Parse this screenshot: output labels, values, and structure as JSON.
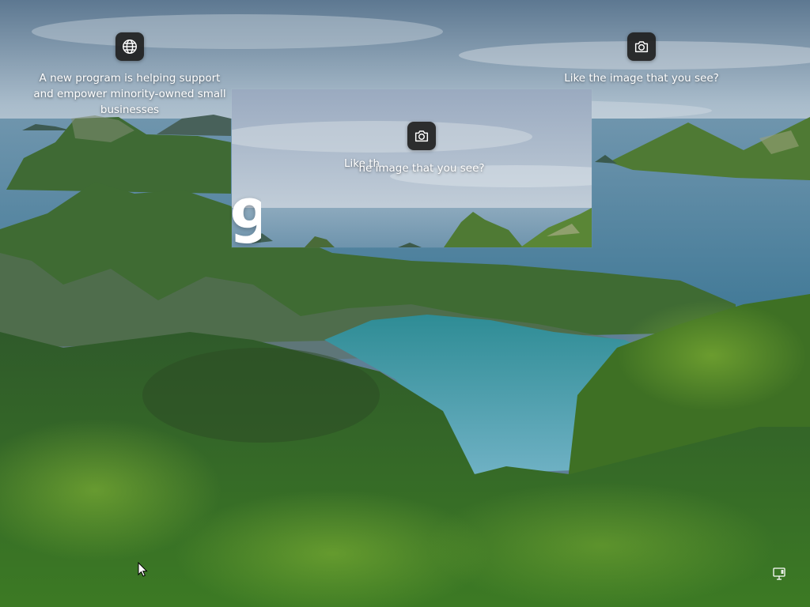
{
  "lock_screen": {
    "spotlight": {
      "news_headline": "A new program is helping support and empower minority-owned small businesses",
      "like_prompt_right": "Like the image that you see?",
      "like_prompt_center": "he image that you see?",
      "like_prompt_center_ghost": "Like the"
    },
    "clock_fragment": "9",
    "icons": {
      "news": "globe-icon",
      "like_right": "camera-icon",
      "like_center": "camera-icon",
      "network": "network-icon",
      "cursor": "mouse-cursor"
    }
  }
}
